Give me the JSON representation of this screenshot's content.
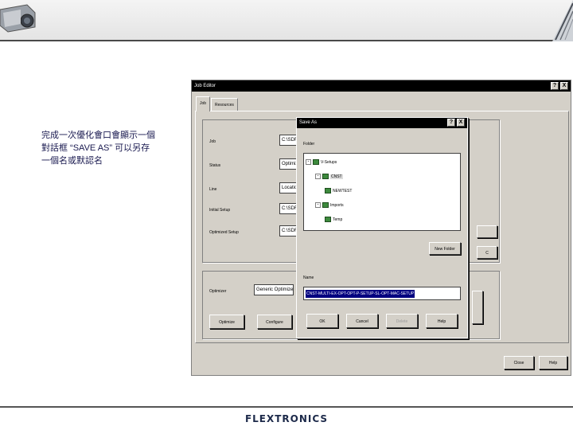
{
  "caption": {
    "line1": "完成一次優化會口會顯示一個",
    "line2": "對話框 “SAVE AS” 可以另存",
    "line3": "一個名或默認名"
  },
  "job_editor": {
    "title": "Job Editor",
    "help_btn": "?",
    "close_btn": "X",
    "tabs": [
      "Job",
      "Resources"
    ],
    "labels": {
      "job": "Job",
      "status": "Status",
      "line": "Line",
      "initial_setup": "Initial Setup",
      "optimized_setup": "Optimized Setup",
      "optimizer": "Optimizer"
    },
    "values": {
      "job": "C:\\SDF",
      "status": "Optimize",
      "line": "Location",
      "initial_setup": "C:\\SDF",
      "optimized_setup": "C:\\SDF",
      "optimizer": "Generic Optimizer"
    },
    "buttons": {
      "optimize": "Optimize",
      "configure": "Configure",
      "right_c": "C",
      "close": "Close",
      "help": "Help"
    }
  },
  "save_as": {
    "title": "Save As",
    "help_btn": "?",
    "close_btn": "X",
    "folder_label": "Folder",
    "tree": [
      {
        "label": "V-Setups",
        "expander": "-"
      },
      {
        "label": "CNST",
        "expander": "-",
        "selected": true
      },
      {
        "label": "NEWTEST",
        "expander": ""
      },
      {
        "label": "Imports",
        "expander": "-"
      },
      {
        "label": "Temp",
        "expander": ""
      }
    ],
    "new_folder_button": "New Folder",
    "name_label": "Name",
    "name_value": "CNST-MULTI-EX-OPT-OPT-P-SETUP-SL-OPT-MAC-SETUP",
    "buttons": {
      "ok": "OK",
      "cancel": "Cancel",
      "delete": "Delete",
      "help": "Help"
    }
  },
  "footer": {
    "logo": "FLEXTRONICS"
  }
}
